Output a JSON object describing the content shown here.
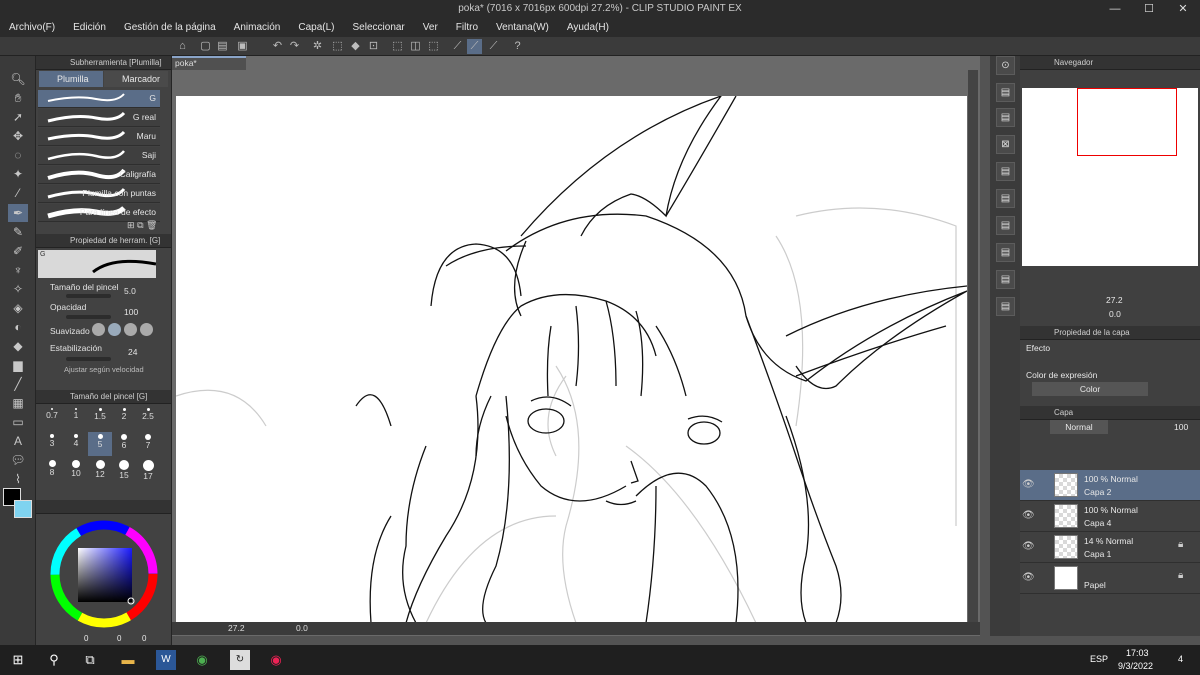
{
  "window": {
    "title": "poka* (7016 x 7016px 600dpi 27.2%)  - CLIP STUDIO PAINT EX",
    "min": "—",
    "max": "☐",
    "close": "✕"
  },
  "menu": [
    "Archivo(F)",
    "Edición",
    "Gestión de la página",
    "Animación",
    "Capa(L)",
    "Seleccionar",
    "Ver",
    "Filtro",
    "Ventana(W)",
    "Ayuda(H)"
  ],
  "subtool": {
    "title": "Subherramienta [Plumilla]",
    "tabs": [
      "Plumilla",
      "Marcador"
    ],
    "brushes": [
      "G",
      "G real",
      "Maru",
      "Saji",
      "Caligrafía",
      "Plumilla con puntas",
      "Para línea de efecto"
    ]
  },
  "toolprop": {
    "title": "Propiedad de herram. [G]",
    "preset": "G",
    "size_label": "Tamaño del pincel",
    "size_value": "5.0",
    "opacity_label": "Opacidad",
    "opacity_value": "100",
    "smoothing_label": "Suavizado",
    "stab_label": "Estabilización",
    "stab_value": "24",
    "speed_label": "Ajustar según velocidad"
  },
  "brushsize": {
    "title": "Tamaño del pincel [G]",
    "sizes": [
      "0.7",
      "1",
      "1.5",
      "2",
      "2.5",
      "3",
      "4",
      "5",
      "6",
      "7",
      "8",
      "10",
      "12",
      "15",
      "17"
    ]
  },
  "colors": {
    "main": "#000000",
    "sub": "#7fd3f0",
    "values": [
      "0",
      "0",
      "0"
    ]
  },
  "document": {
    "tab": "poka*"
  },
  "status": {
    "zoom": "27.2",
    "angle": "0.0"
  },
  "navigator": {
    "title": "Navegador",
    "zoom": "27.2",
    "angle": "0.0"
  },
  "layerprop": {
    "title": "Propiedad de la capa",
    "effect": "Efecto",
    "expr_label": "Color de expresión",
    "expr_value": "Color"
  },
  "layers": {
    "title": "Capa",
    "blend": "Normal",
    "opacity": "100",
    "items": [
      {
        "mode": "100 % Normal",
        "name": "Capa 2"
      },
      {
        "mode": "100 % Normal",
        "name": "Capa 4"
      },
      {
        "mode": "14 % Normal",
        "name": "Capa 1"
      },
      {
        "mode": "",
        "name": "Papel"
      }
    ]
  },
  "taskbar": {
    "lang": "ESP",
    "time": "17:03",
    "date": "9/3/2022",
    "notif": "4"
  }
}
